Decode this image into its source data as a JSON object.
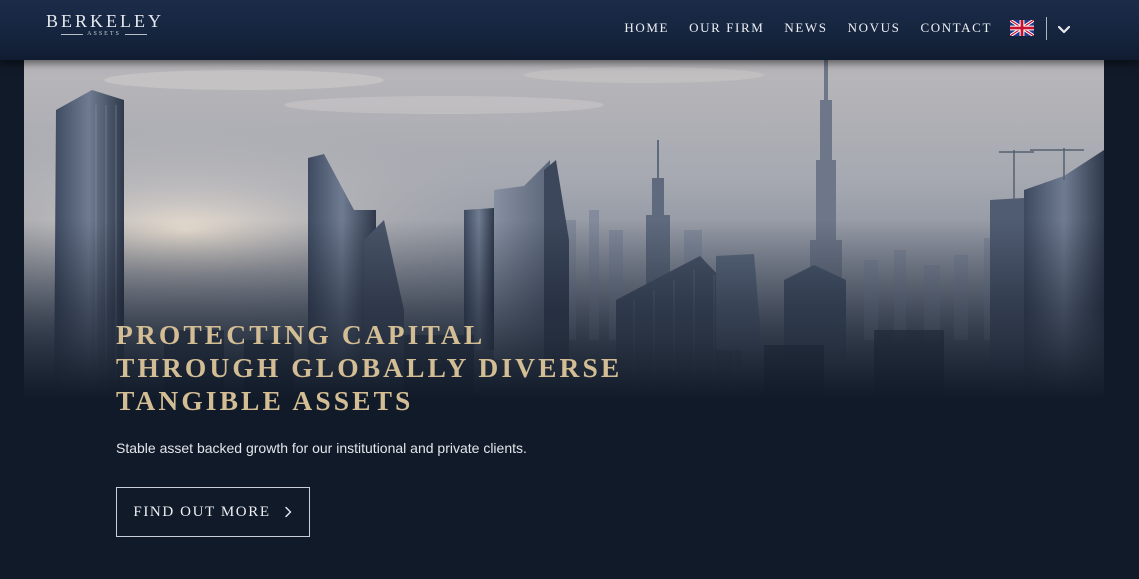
{
  "brand": {
    "name": "BERKELEY",
    "tagline": "ASSETS"
  },
  "nav": {
    "items": [
      {
        "label": "HOME"
      },
      {
        "label": "OUR FIRM"
      },
      {
        "label": "NEWS"
      },
      {
        "label": "NOVUS"
      },
      {
        "label": "CONTACT"
      }
    ],
    "language": {
      "icon": "uk-flag-icon",
      "dropdown_icon": "chevron-down-icon"
    }
  },
  "hero": {
    "headline_lines": [
      "PROTECTING CAPITAL",
      "THROUGH GLOBALLY DIVERSE",
      "TANGIBLE ASSETS"
    ],
    "subtext": "Stable asset backed growth for our institutional and private clients.",
    "cta": {
      "label": "FIND OUT MORE",
      "icon": "chevron-right-icon"
    }
  },
  "colors": {
    "header_bg": "#17263f",
    "page_bg": "#111a28",
    "headline_gold": "#d3bd94",
    "text_light": "#eef0f4"
  }
}
